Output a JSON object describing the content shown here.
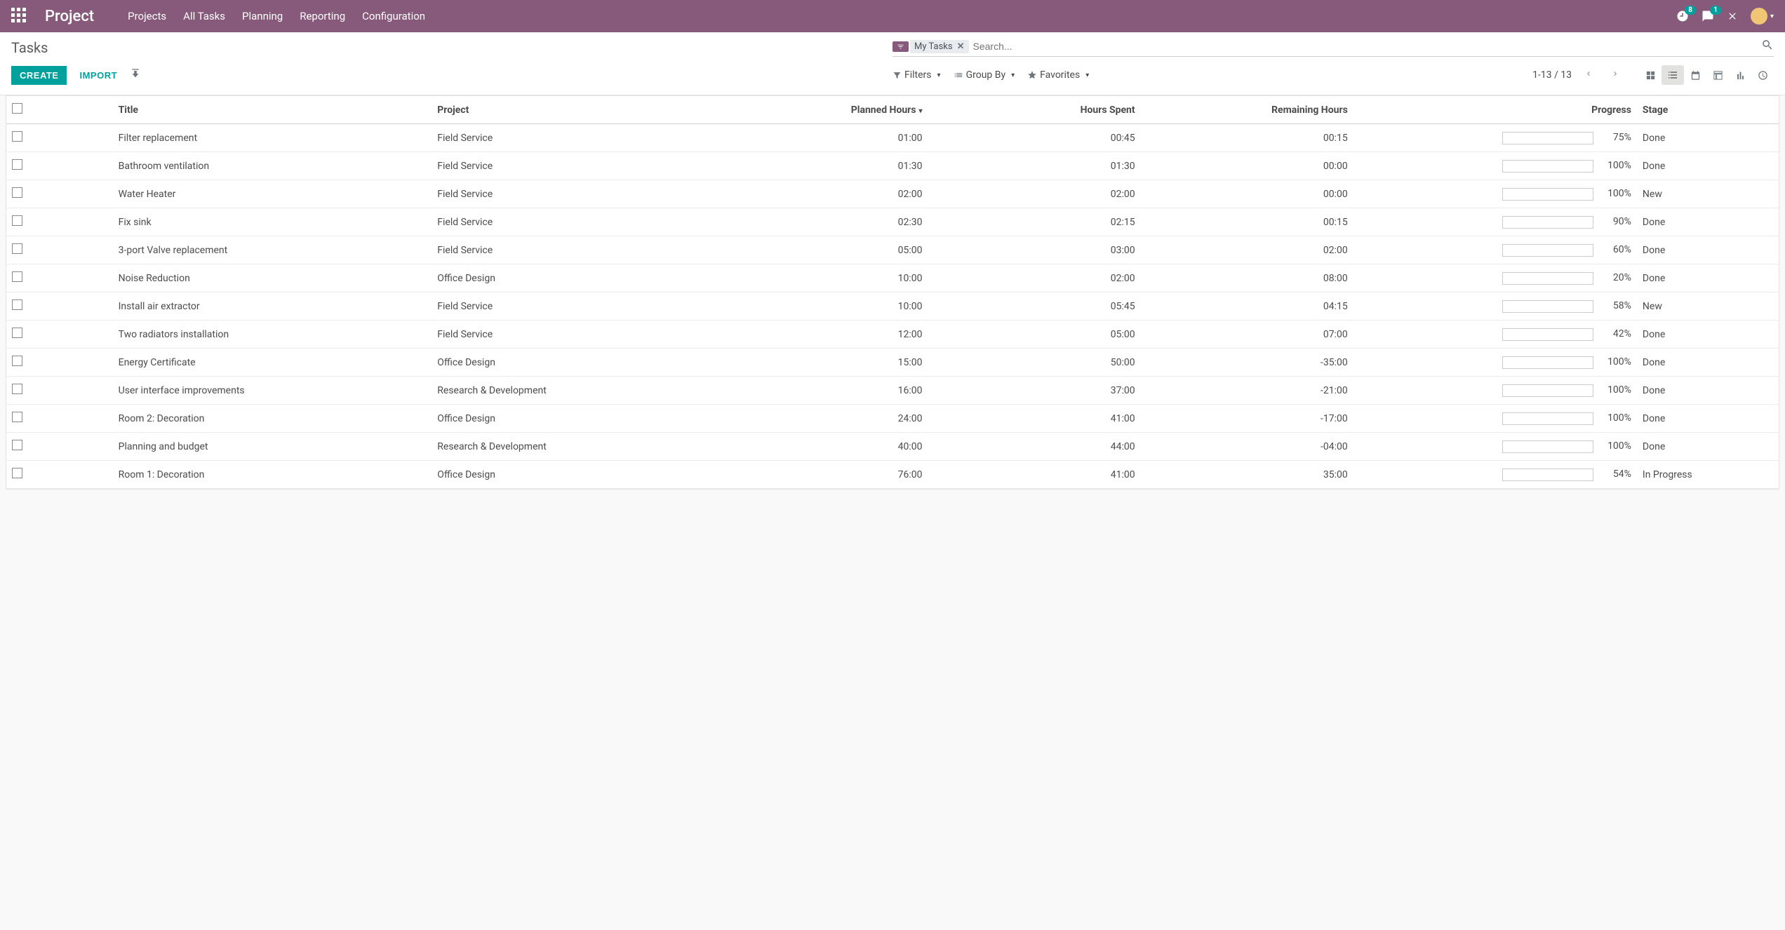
{
  "navbar": {
    "brand": "Project",
    "menu": [
      "Projects",
      "All Tasks",
      "Planning",
      "Reporting",
      "Configuration"
    ],
    "timer_badge": "8",
    "chat_badge": "1"
  },
  "control_panel": {
    "title": "Tasks",
    "create_label": "CREATE",
    "import_label": "IMPORT",
    "search_filter_chip": "My Tasks",
    "search_placeholder": "Search...",
    "filters_label": "Filters",
    "groupby_label": "Group By",
    "favorites_label": "Favorites",
    "pager": "1-13 / 13"
  },
  "table": {
    "headers": {
      "title": "Title",
      "project": "Project",
      "planned": "Planned Hours",
      "spent": "Hours Spent",
      "remaining": "Remaining Hours",
      "progress": "Progress",
      "stage": "Stage"
    },
    "rows": [
      {
        "title": "Filter replacement",
        "project": "Field Service",
        "planned": "01:00",
        "spent": "00:45",
        "remaining": "00:15",
        "progress": 75,
        "progress_label": "75%",
        "stage": "Done"
      },
      {
        "title": "Bathroom ventilation",
        "project": "Field Service",
        "planned": "01:30",
        "spent": "01:30",
        "remaining": "00:00",
        "progress": 100,
        "progress_label": "100%",
        "stage": "Done"
      },
      {
        "title": "Water Heater",
        "project": "Field Service",
        "planned": "02:00",
        "spent": "02:00",
        "remaining": "00:00",
        "progress": 100,
        "progress_label": "100%",
        "stage": "New"
      },
      {
        "title": "Fix sink",
        "project": "Field Service",
        "planned": "02:30",
        "spent": "02:15",
        "remaining": "00:15",
        "progress": 90,
        "progress_label": "90%",
        "stage": "Done"
      },
      {
        "title": "3-port Valve replacement",
        "project": "Field Service",
        "planned": "05:00",
        "spent": "03:00",
        "remaining": "02:00",
        "progress": 60,
        "progress_label": "60%",
        "stage": "Done"
      },
      {
        "title": "Noise Reduction",
        "project": "Office Design",
        "planned": "10:00",
        "spent": "02:00",
        "remaining": "08:00",
        "progress": 20,
        "progress_label": "20%",
        "stage": "Done"
      },
      {
        "title": "Install air extractor",
        "project": "Field Service",
        "planned": "10:00",
        "spent": "05:45",
        "remaining": "04:15",
        "progress": 58,
        "progress_label": "58%",
        "stage": "New"
      },
      {
        "title": "Two radiators installation",
        "project": "Field Service",
        "planned": "12:00",
        "spent": "05:00",
        "remaining": "07:00",
        "progress": 42,
        "progress_label": "42%",
        "stage": "Done"
      },
      {
        "title": "Energy Certificate",
        "project": "Office Design",
        "planned": "15:00",
        "spent": "50:00",
        "remaining": "-35:00",
        "progress": 100,
        "progress_label": "100%",
        "stage": "Done"
      },
      {
        "title": "User interface improvements",
        "project": "Research & Development",
        "planned": "16:00",
        "spent": "37:00",
        "remaining": "-21:00",
        "progress": 100,
        "progress_label": "100%",
        "stage": "Done"
      },
      {
        "title": "Room 2: Decoration",
        "project": "Office Design",
        "planned": "24:00",
        "spent": "41:00",
        "remaining": "-17:00",
        "progress": 100,
        "progress_label": "100%",
        "stage": "Done"
      },
      {
        "title": "Planning and budget",
        "project": "Research & Development",
        "planned": "40:00",
        "spent": "44:00",
        "remaining": "-04:00",
        "progress": 100,
        "progress_label": "100%",
        "stage": "Done"
      },
      {
        "title": "Room 1: Decoration",
        "project": "Office Design",
        "planned": "76:00",
        "spent": "41:00",
        "remaining": "35:00",
        "progress": 54,
        "progress_label": "54%",
        "stage": "In Progress"
      }
    ]
  }
}
